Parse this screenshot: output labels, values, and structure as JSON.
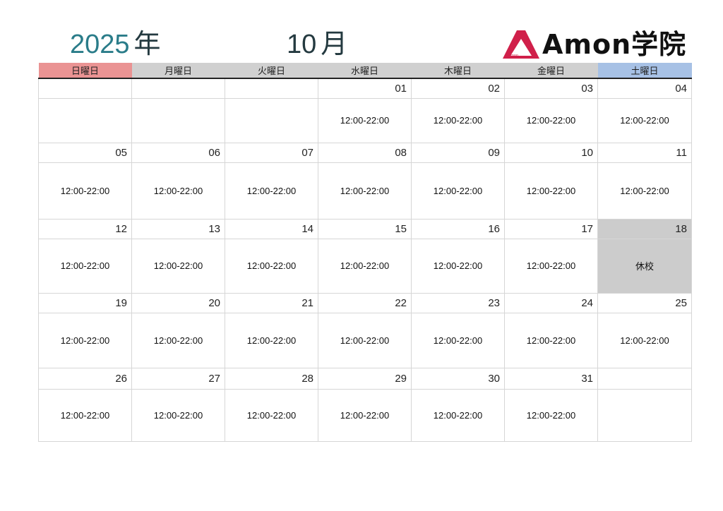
{
  "header": {
    "year": "2025",
    "year_suffix": "年",
    "month": "10",
    "month_suffix": "月"
  },
  "logo": {
    "mark_text": "amon",
    "text": "Amon学院",
    "mark_color": "#d0204a"
  },
  "colors": {
    "sunday_header": "#ea9393",
    "saturday_header": "#a7c1e5",
    "weekday_header": "#d0d0d0",
    "closed_cell": "#cccccc",
    "year_number": "#2a7c89"
  },
  "weekdays": [
    "日曜日",
    "月曜日",
    "火曜日",
    "水曜日",
    "木曜日",
    "金曜日",
    "土曜日"
  ],
  "weeks": [
    [
      {
        "date": "",
        "note": ""
      },
      {
        "date": "",
        "note": ""
      },
      {
        "date": "",
        "note": ""
      },
      {
        "date": "01",
        "note": "12:00-22:00"
      },
      {
        "date": "02",
        "note": "12:00-22:00"
      },
      {
        "date": "03",
        "note": "12:00-22:00"
      },
      {
        "date": "04",
        "note": "12:00-22:00"
      }
    ],
    [
      {
        "date": "05",
        "note": "12:00-22:00"
      },
      {
        "date": "06",
        "note": "12:00-22:00"
      },
      {
        "date": "07",
        "note": "12:00-22:00"
      },
      {
        "date": "08",
        "note": "12:00-22:00"
      },
      {
        "date": "09",
        "note": "12:00-22:00"
      },
      {
        "date": "10",
        "note": "12:00-22:00"
      },
      {
        "date": "11",
        "note": "12:00-22:00"
      }
    ],
    [
      {
        "date": "12",
        "note": "12:00-22:00"
      },
      {
        "date": "13",
        "note": "12:00-22:00"
      },
      {
        "date": "14",
        "note": "12:00-22:00"
      },
      {
        "date": "15",
        "note": "12:00-22:00"
      },
      {
        "date": "16",
        "note": "12:00-22:00"
      },
      {
        "date": "17",
        "note": "12:00-22:00"
      },
      {
        "date": "18",
        "note": "休校",
        "closed": true
      }
    ],
    [
      {
        "date": "19",
        "note": "12:00-22:00"
      },
      {
        "date": "20",
        "note": "12:00-22:00"
      },
      {
        "date": "21",
        "note": "12:00-22:00"
      },
      {
        "date": "22",
        "note": "12:00-22:00"
      },
      {
        "date": "23",
        "note": "12:00-22:00"
      },
      {
        "date": "24",
        "note": "12:00-22:00"
      },
      {
        "date": "25",
        "note": "12:00-22:00"
      }
    ],
    [
      {
        "date": "26",
        "note": "12:00-22:00"
      },
      {
        "date": "27",
        "note": "12:00-22:00"
      },
      {
        "date": "28",
        "note": "12:00-22:00"
      },
      {
        "date": "29",
        "note": "12:00-22:00"
      },
      {
        "date": "30",
        "note": "12:00-22:00"
      },
      {
        "date": "31",
        "note": "12:00-22:00"
      },
      {
        "date": "",
        "note": ""
      }
    ]
  ]
}
